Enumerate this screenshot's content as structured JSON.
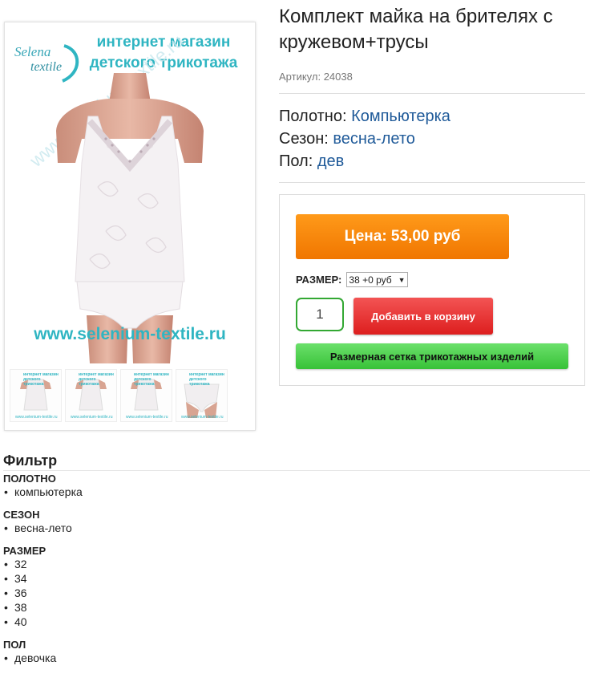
{
  "image": {
    "logo_line1": "Selena",
    "logo_line2": "textile",
    "shop_title_line1": "интернет магазин",
    "shop_title_line2": "детского трикотажа",
    "watermark": "www.selenium-textile.ru",
    "site_url": "www.selenium-textile.ru",
    "thumbs": [
      {
        "title": "интернет магазин детского трикотажа",
        "url": "www.selenium-textile.ru"
      },
      {
        "title": "интернет магазин детского трикотажа",
        "url": "www.selenium-textile.ru"
      },
      {
        "title": "интернет магазин детского трикотажа",
        "url": "www.selenium-textile.ru"
      },
      {
        "title": "интернет магазин детского трикотажа",
        "url": "www.selenium-textile.ru"
      }
    ]
  },
  "product": {
    "title": "Комплект майка на брителях с кружевом+трусы",
    "sku": "Артикул: 24038",
    "attrs": [
      {
        "label": "Полотно: ",
        "value": "Компьютерка"
      },
      {
        "label": "Сезон: ",
        "value": "весна-лето"
      },
      {
        "label": "Пол: ",
        "value": "дев"
      }
    ]
  },
  "buy": {
    "price_label": "Цена: 53,00 руб",
    "size_label": "РАЗМЕР:",
    "size_selected": "38 +0 руб",
    "qty": "1",
    "add_to_cart": "Добавить в корзину",
    "size_chart": "Размерная сетка трикотажных изделий"
  },
  "filter": {
    "title": "Фильтр",
    "groups": [
      {
        "title": "ПОЛОТНО",
        "items": [
          "компьютерка"
        ]
      },
      {
        "title": "СЕЗОН",
        "items": [
          "весна-лето"
        ]
      },
      {
        "title": "РАЗМЕР",
        "items": [
          "32",
          "34",
          "36",
          "38",
          "40"
        ]
      },
      {
        "title": "ПОЛ",
        "items": [
          "девочка"
        ]
      }
    ]
  },
  "colors": {
    "accent_text": "#1f5a99",
    "price_button": "#f68a0d",
    "cart_button": "#e53030",
    "size_chart_button": "#4fd04f",
    "brand_teal": "#2fb5c2"
  }
}
